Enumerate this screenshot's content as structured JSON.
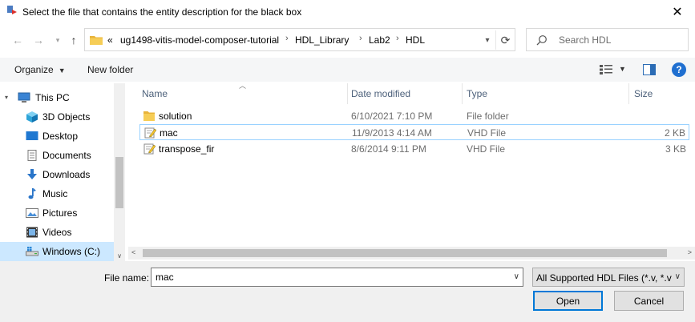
{
  "window": {
    "title": "Select the file that contains the entity description for the black box"
  },
  "nav": {
    "path": [
      {
        "label": "«"
      },
      {
        "label": "ug1498-vitis-model-composer-tutorial"
      },
      {
        "label": "HDL_Library"
      },
      {
        "label": "Lab2"
      },
      {
        "label": "HDL"
      }
    ],
    "search_placeholder": "Search HDL"
  },
  "toolbar": {
    "organize": "Organize",
    "new_folder": "New folder"
  },
  "sidebar": {
    "items": [
      {
        "label": "This PC",
        "icon": "computer-icon"
      },
      {
        "label": "3D Objects",
        "icon": "cube-icon"
      },
      {
        "label": "Desktop",
        "icon": "desktop-icon"
      },
      {
        "label": "Documents",
        "icon": "document-icon"
      },
      {
        "label": "Downloads",
        "icon": "download-icon"
      },
      {
        "label": "Music",
        "icon": "music-icon"
      },
      {
        "label": "Pictures",
        "icon": "picture-icon"
      },
      {
        "label": "Videos",
        "icon": "video-icon"
      },
      {
        "label": "Windows (C:)",
        "icon": "drive-icon"
      }
    ]
  },
  "files": {
    "columns": {
      "name": "Name",
      "date": "Date modified",
      "type": "Type",
      "size": "Size"
    },
    "rows": [
      {
        "name": "solution",
        "date": "6/10/2021 7:10 PM",
        "type": "File folder",
        "size": "",
        "icon": "folder-icon"
      },
      {
        "name": "mac",
        "date": "11/9/2013 4:14 AM",
        "type": "VHD File",
        "size": "2 KB",
        "icon": "vhd-file-icon"
      },
      {
        "name": "transpose_fir",
        "date": "8/6/2014 9:11 PM",
        "type": "VHD File",
        "size": "3 KB",
        "icon": "vhd-file-icon"
      }
    ]
  },
  "footer": {
    "file_name_label": "File name:",
    "file_name_value": "mac",
    "filter": "All Supported HDL Files  (*.v, *.v",
    "open": "Open",
    "cancel": "Cancel"
  }
}
